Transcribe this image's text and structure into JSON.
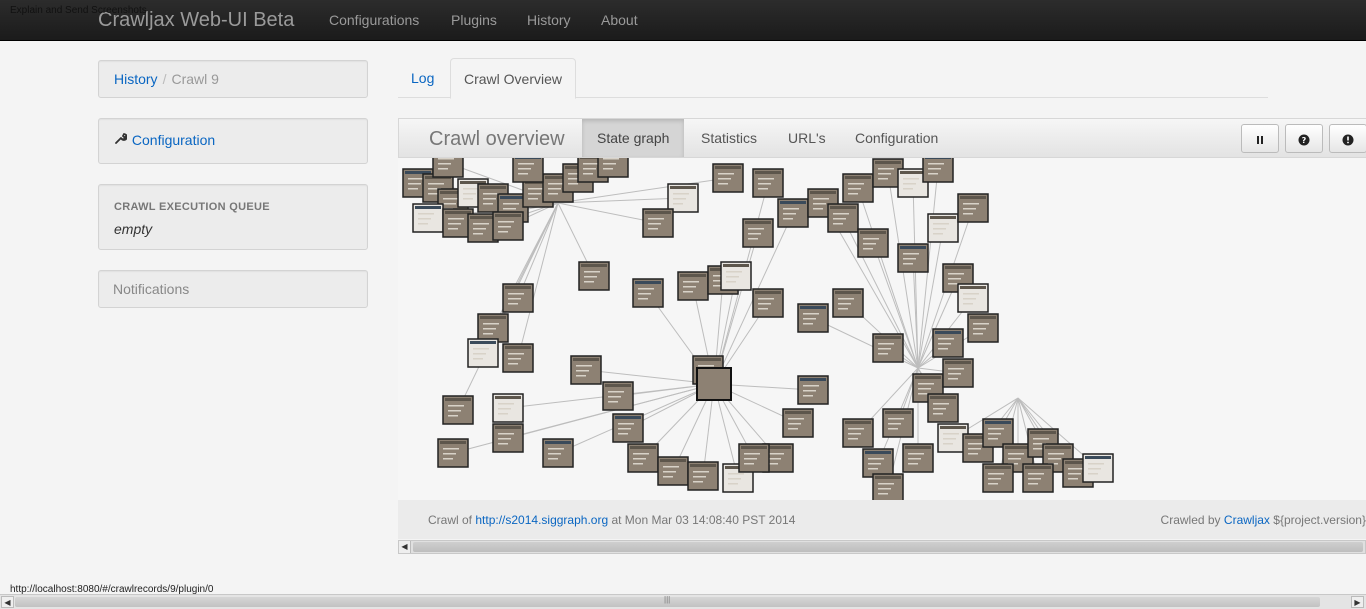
{
  "navbar": {
    "brand": "Crawljax Web-UI Beta",
    "items": [
      "Configurations",
      "Plugins",
      "History",
      "About"
    ],
    "overlay_caption": "Explain and Send Screenshots"
  },
  "sidebar": {
    "breadcrumb": {
      "parent": "History",
      "separator": "/",
      "current": "Crawl 9"
    },
    "configuration_link": "Configuration",
    "queue": {
      "header": "CRAWL EXECUTION QUEUE",
      "value": "empty"
    },
    "notifications": "Notifications"
  },
  "tabs": {
    "log": "Log",
    "overview": "Crawl Overview"
  },
  "overview": {
    "title": "Crawl overview",
    "subtabs": [
      "State graph",
      "Statistics",
      "URL's",
      "Configuration"
    ],
    "active_subtab": "State graph",
    "buttons": {
      "pause": "pause-icon",
      "help": "help-icon",
      "power": "power-icon"
    }
  },
  "graph": {
    "node_color": "#8d8173",
    "edge_color": "#bdbdbd"
  },
  "footer": {
    "prefix": "Crawl of",
    "url": "http://s2014.siggraph.org",
    "timestamp": "at Mon Mar 03 14:08:40 PST 2014",
    "crawled_by": "Crawled by",
    "crawljax": "Crawljax",
    "version": "${project.version}"
  },
  "status_bar": {
    "url": "http://localhost:8080/#/crawlrecords/9/plugin/0"
  }
}
